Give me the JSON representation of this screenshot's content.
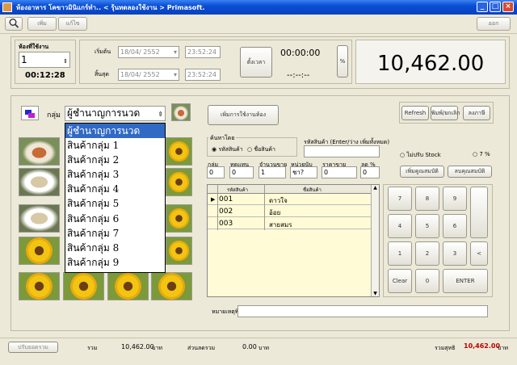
{
  "window": {
    "title": "ห้องอาหาร โคขาวมินิแกร์ทำ.. < รุ้นทดลองใช้งาน > Primasoft.",
    "buttons": {
      "minimize": "_",
      "maximize": "□",
      "close": "×"
    }
  },
  "toolbar": {
    "btn1": "เพิ่ม",
    "btn2": "แก้ไข",
    "exit": "ออก"
  },
  "room": {
    "label": "ห้องที่ใช้งาน",
    "value": "1",
    "timer": "00:12:28"
  },
  "timing": {
    "start_label": "เริ่มต้น",
    "start_date": "18/04/ 2552",
    "start_time": "23:52:24",
    "end_label": "สิ้นสุด",
    "end_date": "18/04/ 2552",
    "end_time": "23:52:24",
    "set_button": "ตั้งเวลา",
    "elapsed": "00:00:00",
    "countdown": "--:--:--",
    "pct_button": "%"
  },
  "total": {
    "amount": "10,462.00"
  },
  "group": {
    "label": "กลุ่ม",
    "selected": "ผู้ชำนาญการนวด",
    "options": [
      "ผู้ชำนาญการนวด",
      "สินค้ากลุ่ม 1",
      "สินค้ากลุ่ม 2",
      "สินค้ากลุ่ม 3",
      "สินค้ากลุ่ม 4",
      "สินค้ากลุ่ม 5",
      "สินค้ากลุ่ม 6",
      "สินค้ากลุ่ม 7",
      "สินค้ากลุ่ม 8",
      "สินค้ากลุ่ม 9"
    ]
  },
  "actions": {
    "add_service": "เพิ่มการใช้งานห้อง",
    "refresh": "Refresh",
    "print": "พิมพ์/ยกเลิก",
    "tax": "ลงภาษี"
  },
  "search": {
    "mode_label": "ค้นหาโดย",
    "opt_code": "รหัสสินค้า",
    "opt_name": "ชื่อสินค้า",
    "code_label": "รหัสสินค้า (Enter/ว่าง เพิ่มทั้งหมด)",
    "code_value": ""
  },
  "options": {
    "no_stock": "ไม่ปรับ Stock",
    "vat": "7 %",
    "btn_a": "เพิ่มคูณสมบัติ",
    "btn_b": "ลบคุณสมบัติ"
  },
  "qty": {
    "labels": [
      "กลุ่ม",
      "ทดแทน",
      "จำนวนขาย",
      "หน่วยนับ",
      "ราคาขาย",
      "ลด %"
    ],
    "values": [
      "0",
      "0",
      "1",
      "ชา?",
      "0",
      "0"
    ]
  },
  "products": {
    "headers": [
      "รหัสสินค้า",
      "ชื่อสินค้า"
    ],
    "rows": [
      {
        "code": "001",
        "name": "ดาวใจ"
      },
      {
        "code": "002",
        "name": "อ้อย"
      },
      {
        "code": "003",
        "name": "สายสมร"
      }
    ]
  },
  "keypad": {
    "keys": [
      "7",
      "8",
      "9",
      "4",
      "5",
      "6",
      "1",
      "2",
      "3",
      "<",
      "Clear",
      "0",
      "ENTER"
    ]
  },
  "note": {
    "label": "หมายเหตุพิเศษ",
    "value": ""
  },
  "status": {
    "btn": "ปรับยอดรวม",
    "total_label": "รวม",
    "total_value": "10,462.00",
    "total_unit": "บาท",
    "discount_label": "ส่วนลดรวม",
    "discount_value": "0.00",
    "discount_unit": "บาท",
    "net_label": "รวมสุทธิ",
    "net_value": "10,462.00",
    "net_unit": "บาท"
  },
  "colors": {
    "accent": "#316AC5",
    "titlebar": "#0A4ED4",
    "net": "#C00000",
    "grid_bg": "#FFFBD6"
  }
}
